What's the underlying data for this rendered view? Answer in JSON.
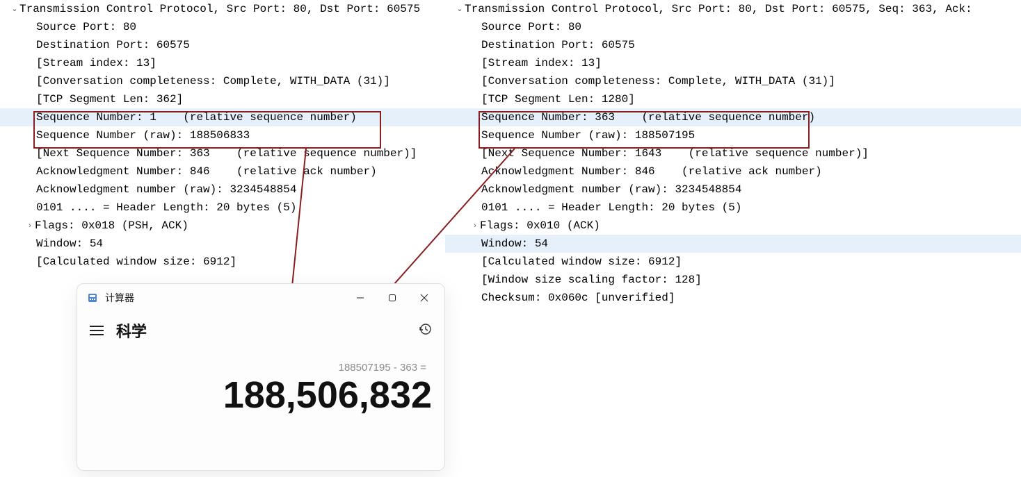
{
  "left": {
    "header": "Transmission Control Protocol, Src Port: 80, Dst Port: 60575",
    "rows": [
      "Source Port: 80",
      "Destination Port: 60575",
      "[Stream index: 13]",
      "[Conversation completeness: Complete, WITH_DATA (31)]",
      "[TCP Segment Len: 362]",
      "Sequence Number: 1    (relative sequence number)",
      "Sequence Number (raw): 188506833",
      "[Next Sequence Number: 363    (relative sequence number)]",
      "Acknowledgment Number: 846    (relative ack number)",
      "Acknowledgment number (raw): 3234548854",
      "0101 .... = Header Length: 20 bytes (5)"
    ],
    "flags": "Flags: 0x018 (PSH, ACK)",
    "tail": [
      "Window: 54",
      "[Calculated window size: 6912]"
    ]
  },
  "right": {
    "header": "Transmission Control Protocol, Src Port: 80, Dst Port: 60575, Seq: 363, Ack:",
    "rows": [
      "Source Port: 80",
      "Destination Port: 60575",
      "[Stream index: 13]",
      "[Conversation completeness: Complete, WITH_DATA (31)]",
      "[TCP Segment Len: 1280]",
      "Sequence Number: 363    (relative sequence number)",
      "Sequence Number (raw): 188507195",
      "[Next Sequence Number: 1643    (relative sequence number)]",
      "Acknowledgment Number: 846    (relative ack number)",
      "Acknowledgment number (raw): 3234548854",
      "0101 .... = Header Length: 20 bytes (5)"
    ],
    "flags": "Flags: 0x010 (ACK)",
    "tail": [
      "Window: 54",
      "[Calculated window size: 6912]",
      "[Window size scaling factor: 128]",
      "Checksum: 0x060c [unverified]"
    ]
  },
  "calc": {
    "title": "计算器",
    "mode": "科学",
    "expression": "188507195 - 363 =",
    "result": "188,506,832"
  }
}
